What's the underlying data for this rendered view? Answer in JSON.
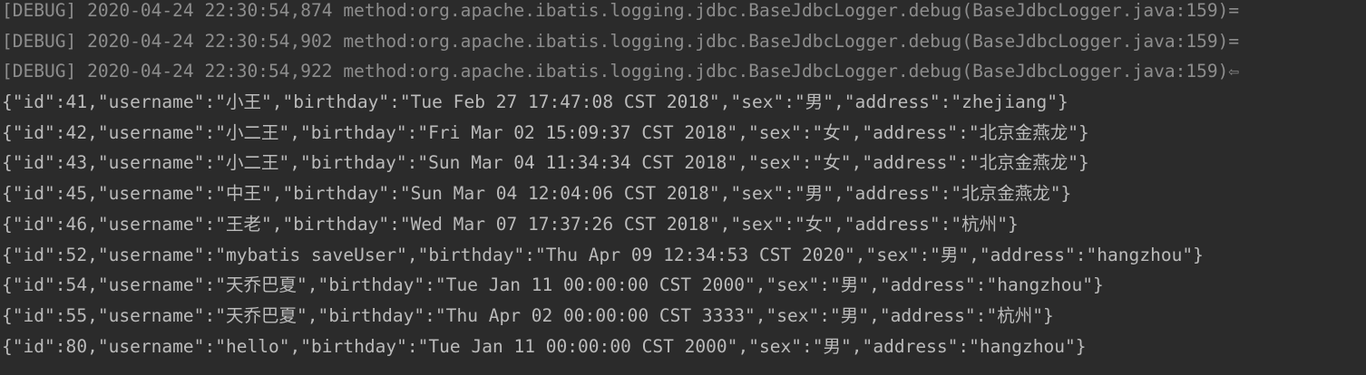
{
  "debug_lines": [
    {
      "text": "[DEBUG] 2020-04-24 22:30:54,874 method:org.apache.ibatis.logging.jdbc.BaseJdbcLogger.debug(BaseJdbcLogger.java:159)=",
      "trail": ""
    },
    {
      "text": "[DEBUG] 2020-04-24 22:30:54,902 method:org.apache.ibatis.logging.jdbc.BaseJdbcLogger.debug(BaseJdbcLogger.java:159)=",
      "trail": ""
    },
    {
      "text": "[DEBUG] 2020-04-24 22:30:54,922 method:org.apache.ibatis.logging.jdbc.BaseJdbcLogger.debug(BaseJdbcLogger.java:159)",
      "trail": "⇦"
    }
  ],
  "output_lines": [
    "{\"id\":41,\"username\":\"小王\",\"birthday\":\"Tue Feb 27 17:47:08 CST 2018\",\"sex\":\"男\",\"address\":\"zhejiang\"}",
    "{\"id\":42,\"username\":\"小二王\",\"birthday\":\"Fri Mar 02 15:09:37 CST 2018\",\"sex\":\"女\",\"address\":\"北京金燕龙\"}",
    "{\"id\":43,\"username\":\"小二王\",\"birthday\":\"Sun Mar 04 11:34:34 CST 2018\",\"sex\":\"女\",\"address\":\"北京金燕龙\"}",
    "{\"id\":45,\"username\":\"中王\",\"birthday\":\"Sun Mar 04 12:04:06 CST 2018\",\"sex\":\"男\",\"address\":\"北京金燕龙\"}",
    "{\"id\":46,\"username\":\"王老\",\"birthday\":\"Wed Mar 07 17:37:26 CST 2018\",\"sex\":\"女\",\"address\":\"杭州\"}",
    "{\"id\":52,\"username\":\"mybatis saveUser\",\"birthday\":\"Thu Apr 09 12:34:53 CST 2020\",\"sex\":\"男\",\"address\":\"hangzhou\"}",
    "{\"id\":54,\"username\":\"天乔巴夏\",\"birthday\":\"Tue Jan 11 00:00:00 CST 2000\",\"sex\":\"男\",\"address\":\"hangzhou\"}",
    "{\"id\":55,\"username\":\"天乔巴夏\",\"birthday\":\"Thu Apr 02 00:00:00 CST 3333\",\"sex\":\"男\",\"address\":\"杭州\"}",
    "{\"id\":80,\"username\":\"hello\",\"birthday\":\"Tue Jan 11 00:00:00 CST 2000\",\"sex\":\"男\",\"address\":\"hangzhou\"}"
  ],
  "colors": {
    "background": "#2b2b2b",
    "debug_text": "#8d8d8d",
    "output_text": "#bbbbbb"
  }
}
